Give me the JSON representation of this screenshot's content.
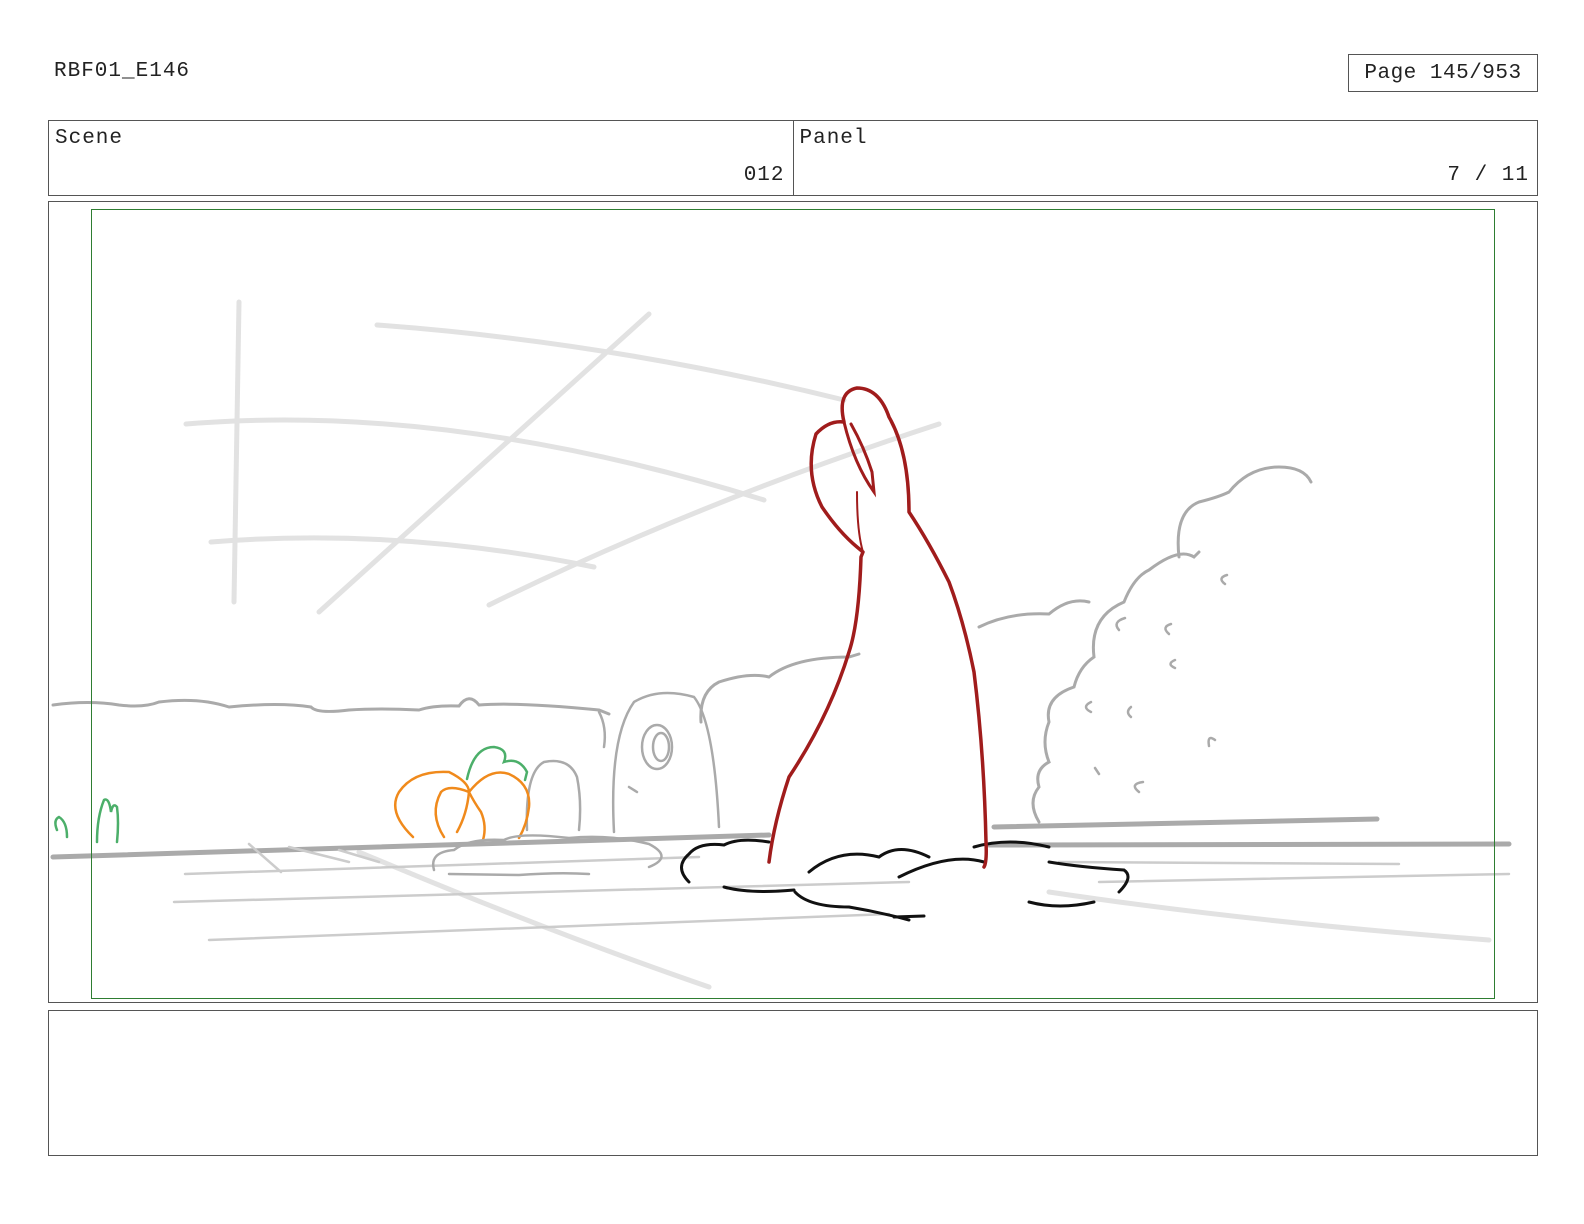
{
  "header": {
    "doc_id": "RBF01_E146",
    "page": "Page 145/953"
  },
  "info": {
    "scene_label": "Scene",
    "scene_value": "012",
    "panel_label": "Panel",
    "panel_value": "7 / 11"
  },
  "colors": {
    "safe_frame": "#2e7d32",
    "character": "#a01c1c",
    "pumpkin": "#f08a1c",
    "pumpkin_stem": "#4caf6a",
    "background_lines": "#aaaaaa",
    "dirt": "#111111"
  },
  "notes": {
    "text": ""
  }
}
